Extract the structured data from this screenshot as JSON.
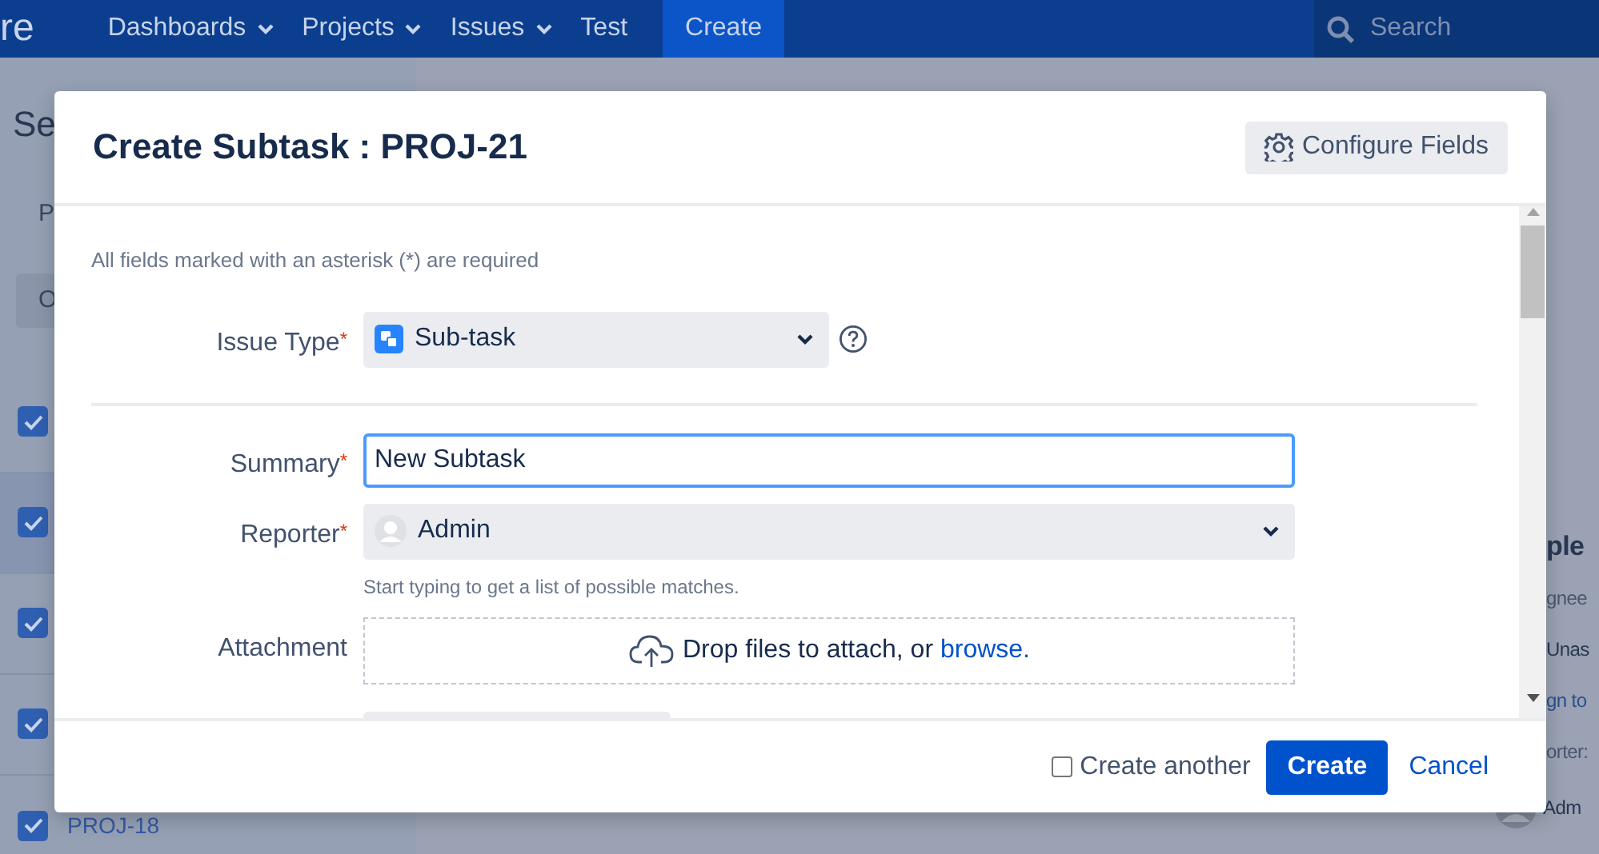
{
  "nav": {
    "logo_fragment": "re",
    "items": [
      {
        "label": "Dashboards",
        "dropdown": true
      },
      {
        "label": "Projects",
        "dropdown": true
      },
      {
        "label": "Issues",
        "dropdown": true
      },
      {
        "label": "Test",
        "dropdown": false
      }
    ],
    "create_button": "Create",
    "search": {
      "placeholder": "Search"
    }
  },
  "background": {
    "heading_fragment": "Se",
    "tab_fragment": "P",
    "button_fragment": "O",
    "rows": [
      {
        "checked": true,
        "selected": false
      },
      {
        "checked": true,
        "selected": true
      },
      {
        "checked": true,
        "selected": false
      },
      {
        "checked": true,
        "selected": false
      },
      {
        "checked": true,
        "selected": false,
        "key": "PROJ-18"
      }
    ],
    "side_heading_fragment": "ple",
    "side_label_fragment": "gnee",
    "side_value_fragment": "Unas",
    "side_link_fragment": "gn to",
    "side_label2_fragment": "orter:",
    "side_user_fragment": "Adm"
  },
  "dialog": {
    "title": "Create Subtask : PROJ-21",
    "configure_button": "Configure Fields",
    "required_note": "All fields marked with an asterisk (*) are required",
    "fields": [
      {
        "kind": "select",
        "label": "Issue Type",
        "required_mark": "*",
        "value": "Sub-task",
        "help": true
      },
      {
        "kind": "text",
        "label": "Summary",
        "required_mark": "*",
        "value": "New Subtask",
        "focused": true
      },
      {
        "kind": "user",
        "label": "Reporter",
        "required_mark": "*",
        "value": "Admin",
        "hint": "Start typing to get a list of possible matches."
      },
      {
        "kind": "attachment",
        "label": "Attachment",
        "text": "Drop files to attach, or ",
        "link": "browse."
      }
    ],
    "create_another": {
      "label": "Create another",
      "checked": false
    },
    "submit_button": "Create",
    "cancel_link": "Cancel"
  }
}
